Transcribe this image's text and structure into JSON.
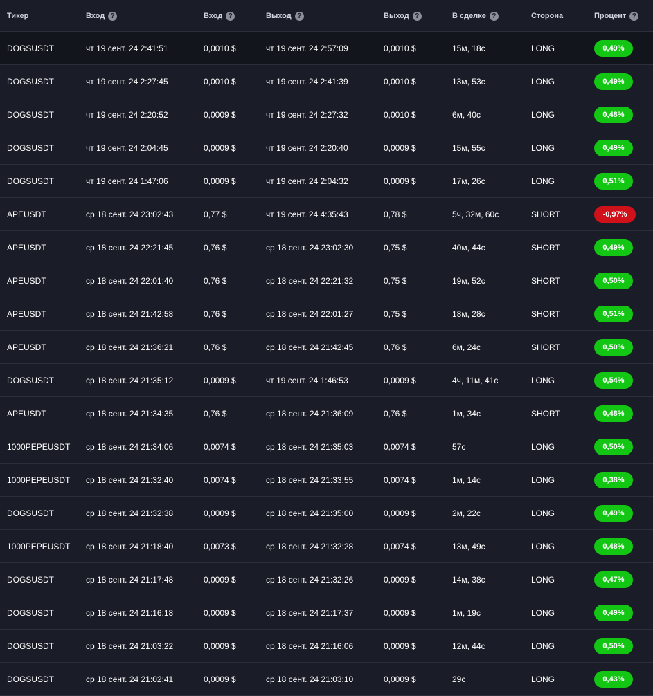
{
  "header": {
    "ticker": "Тикер",
    "entry_time": "Вход",
    "entry_price": "Вход",
    "exit_time": "Выход",
    "exit_price": "Выход",
    "in_trade": "В сделке",
    "side": "Сторона",
    "percent": "Процент",
    "help_glyph": "?"
  },
  "colors": {
    "positive": "#14c614",
    "negative": "#d0111a",
    "background": "#1a1d27"
  },
  "rows": [
    {
      "ticker": "DOGSUSDT",
      "entry_time": "чт 19 сент. 24 2:41:51",
      "entry_price": "0,0010 $",
      "exit_time": "чт 19 сент. 24 2:57:09",
      "exit_price": "0,0010 $",
      "duration": "15м, 18с",
      "side": "LONG",
      "percent": "0,49%",
      "positive": true
    },
    {
      "ticker": "DOGSUSDT",
      "entry_time": "чт 19 сент. 24 2:27:45",
      "entry_price": "0,0010 $",
      "exit_time": "чт 19 сент. 24 2:41:39",
      "exit_price": "0,0010 $",
      "duration": "13м, 53с",
      "side": "LONG",
      "percent": "0,49%",
      "positive": true
    },
    {
      "ticker": "DOGSUSDT",
      "entry_time": "чт 19 сент. 24 2:20:52",
      "entry_price": "0,0009 $",
      "exit_time": "чт 19 сент. 24 2:27:32",
      "exit_price": "0,0010 $",
      "duration": "6м, 40с",
      "side": "LONG",
      "percent": "0,48%",
      "positive": true
    },
    {
      "ticker": "DOGSUSDT",
      "entry_time": "чт 19 сент. 24 2:04:45",
      "entry_price": "0,0009 $",
      "exit_time": "чт 19 сент. 24 2:20:40",
      "exit_price": "0,0009 $",
      "duration": "15м, 55с",
      "side": "LONG",
      "percent": "0,49%",
      "positive": true
    },
    {
      "ticker": "DOGSUSDT",
      "entry_time": "чт 19 сент. 24 1:47:06",
      "entry_price": "0,0009 $",
      "exit_time": "чт 19 сент. 24 2:04:32",
      "exit_price": "0,0009 $",
      "duration": "17м, 26с",
      "side": "LONG",
      "percent": "0,51%",
      "positive": true
    },
    {
      "ticker": "APEUSDT",
      "entry_time": "ср 18 сент. 24 23:02:43",
      "entry_price": "0,77 $",
      "exit_time": "чт 19 сент. 24 4:35:43",
      "exit_price": "0,78 $",
      "duration": "5ч, 32м, 60с",
      "side": "SHORT",
      "percent": "-0,97%",
      "positive": false
    },
    {
      "ticker": "APEUSDT",
      "entry_time": "ср 18 сент. 24 22:21:45",
      "entry_price": "0,76 $",
      "exit_time": "ср 18 сент. 24 23:02:30",
      "exit_price": "0,75 $",
      "duration": "40м, 44с",
      "side": "SHORT",
      "percent": "0,49%",
      "positive": true
    },
    {
      "ticker": "APEUSDT",
      "entry_time": "ср 18 сент. 24 22:01:40",
      "entry_price": "0,76 $",
      "exit_time": "ср 18 сент. 24 22:21:32",
      "exit_price": "0,75 $",
      "duration": "19м, 52с",
      "side": "SHORT",
      "percent": "0,50%",
      "positive": true
    },
    {
      "ticker": "APEUSDT",
      "entry_time": "ср 18 сент. 24 21:42:58",
      "entry_price": "0,76 $",
      "exit_time": "ср 18 сент. 24 22:01:27",
      "exit_price": "0,75 $",
      "duration": "18м, 28с",
      "side": "SHORT",
      "percent": "0,51%",
      "positive": true
    },
    {
      "ticker": "APEUSDT",
      "entry_time": "ср 18 сент. 24 21:36:21",
      "entry_price": "0,76 $",
      "exit_time": "ср 18 сент. 24 21:42:45",
      "exit_price": "0,76 $",
      "duration": "6м, 24с",
      "side": "SHORT",
      "percent": "0,50%",
      "positive": true
    },
    {
      "ticker": "DOGSUSDT",
      "entry_time": "ср 18 сент. 24 21:35:12",
      "entry_price": "0,0009 $",
      "exit_time": "чт 19 сент. 24 1:46:53",
      "exit_price": "0,0009 $",
      "duration": "4ч, 11м, 41с",
      "side": "LONG",
      "percent": "0,54%",
      "positive": true
    },
    {
      "ticker": "APEUSDT",
      "entry_time": "ср 18 сент. 24 21:34:35",
      "entry_price": "0,76 $",
      "exit_time": "ср 18 сент. 24 21:36:09",
      "exit_price": "0,76 $",
      "duration": "1м, 34с",
      "side": "SHORT",
      "percent": "0,48%",
      "positive": true
    },
    {
      "ticker": "1000PEPEUSDT",
      "entry_time": "ср 18 сент. 24 21:34:06",
      "entry_price": "0,0074 $",
      "exit_time": "ср 18 сент. 24 21:35:03",
      "exit_price": "0,0074 $",
      "duration": "57с",
      "side": "LONG",
      "percent": "0,50%",
      "positive": true
    },
    {
      "ticker": "1000PEPEUSDT",
      "entry_time": "ср 18 сент. 24 21:32:40",
      "entry_price": "0,0074 $",
      "exit_time": "ср 18 сент. 24 21:33:55",
      "exit_price": "0,0074 $",
      "duration": "1м, 14с",
      "side": "LONG",
      "percent": "0,38%",
      "positive": true
    },
    {
      "ticker": "DOGSUSDT",
      "entry_time": "ср 18 сент. 24 21:32:38",
      "entry_price": "0,0009 $",
      "exit_time": "ср 18 сент. 24 21:35:00",
      "exit_price": "0,0009 $",
      "duration": "2м, 22с",
      "side": "LONG",
      "percent": "0,49%",
      "positive": true
    },
    {
      "ticker": "1000PEPEUSDT",
      "entry_time": "ср 18 сент. 24 21:18:40",
      "entry_price": "0,0073 $",
      "exit_time": "ср 18 сент. 24 21:32:28",
      "exit_price": "0,0074 $",
      "duration": "13м, 49с",
      "side": "LONG",
      "percent": "0,48%",
      "positive": true
    },
    {
      "ticker": "DOGSUSDT",
      "entry_time": "ср 18 сент. 24 21:17:48",
      "entry_price": "0,0009 $",
      "exit_time": "ср 18 сент. 24 21:32:26",
      "exit_price": "0,0009 $",
      "duration": "14м, 38с",
      "side": "LONG",
      "percent": "0,47%",
      "positive": true
    },
    {
      "ticker": "DOGSUSDT",
      "entry_time": "ср 18 сент. 24 21:16:18",
      "entry_price": "0,0009 $",
      "exit_time": "ср 18 сент. 24 21:17:37",
      "exit_price": "0,0009 $",
      "duration": "1м, 19с",
      "side": "LONG",
      "percent": "0,49%",
      "positive": true
    },
    {
      "ticker": "DOGSUSDT",
      "entry_time": "ср 18 сент. 24 21:03:22",
      "entry_price": "0,0009 $",
      "exit_time": "ср 18 сент. 24 21:16:06",
      "exit_price": "0,0009 $",
      "duration": "12м, 44с",
      "side": "LONG",
      "percent": "0,50%",
      "positive": true
    },
    {
      "ticker": "DOGSUSDT",
      "entry_time": "ср 18 сент. 24 21:02:41",
      "entry_price": "0,0009 $",
      "exit_time": "ср 18 сент. 24 21:03:10",
      "exit_price": "0,0009 $",
      "duration": "29с",
      "side": "LONG",
      "percent": "0,43%",
      "positive": true
    }
  ]
}
